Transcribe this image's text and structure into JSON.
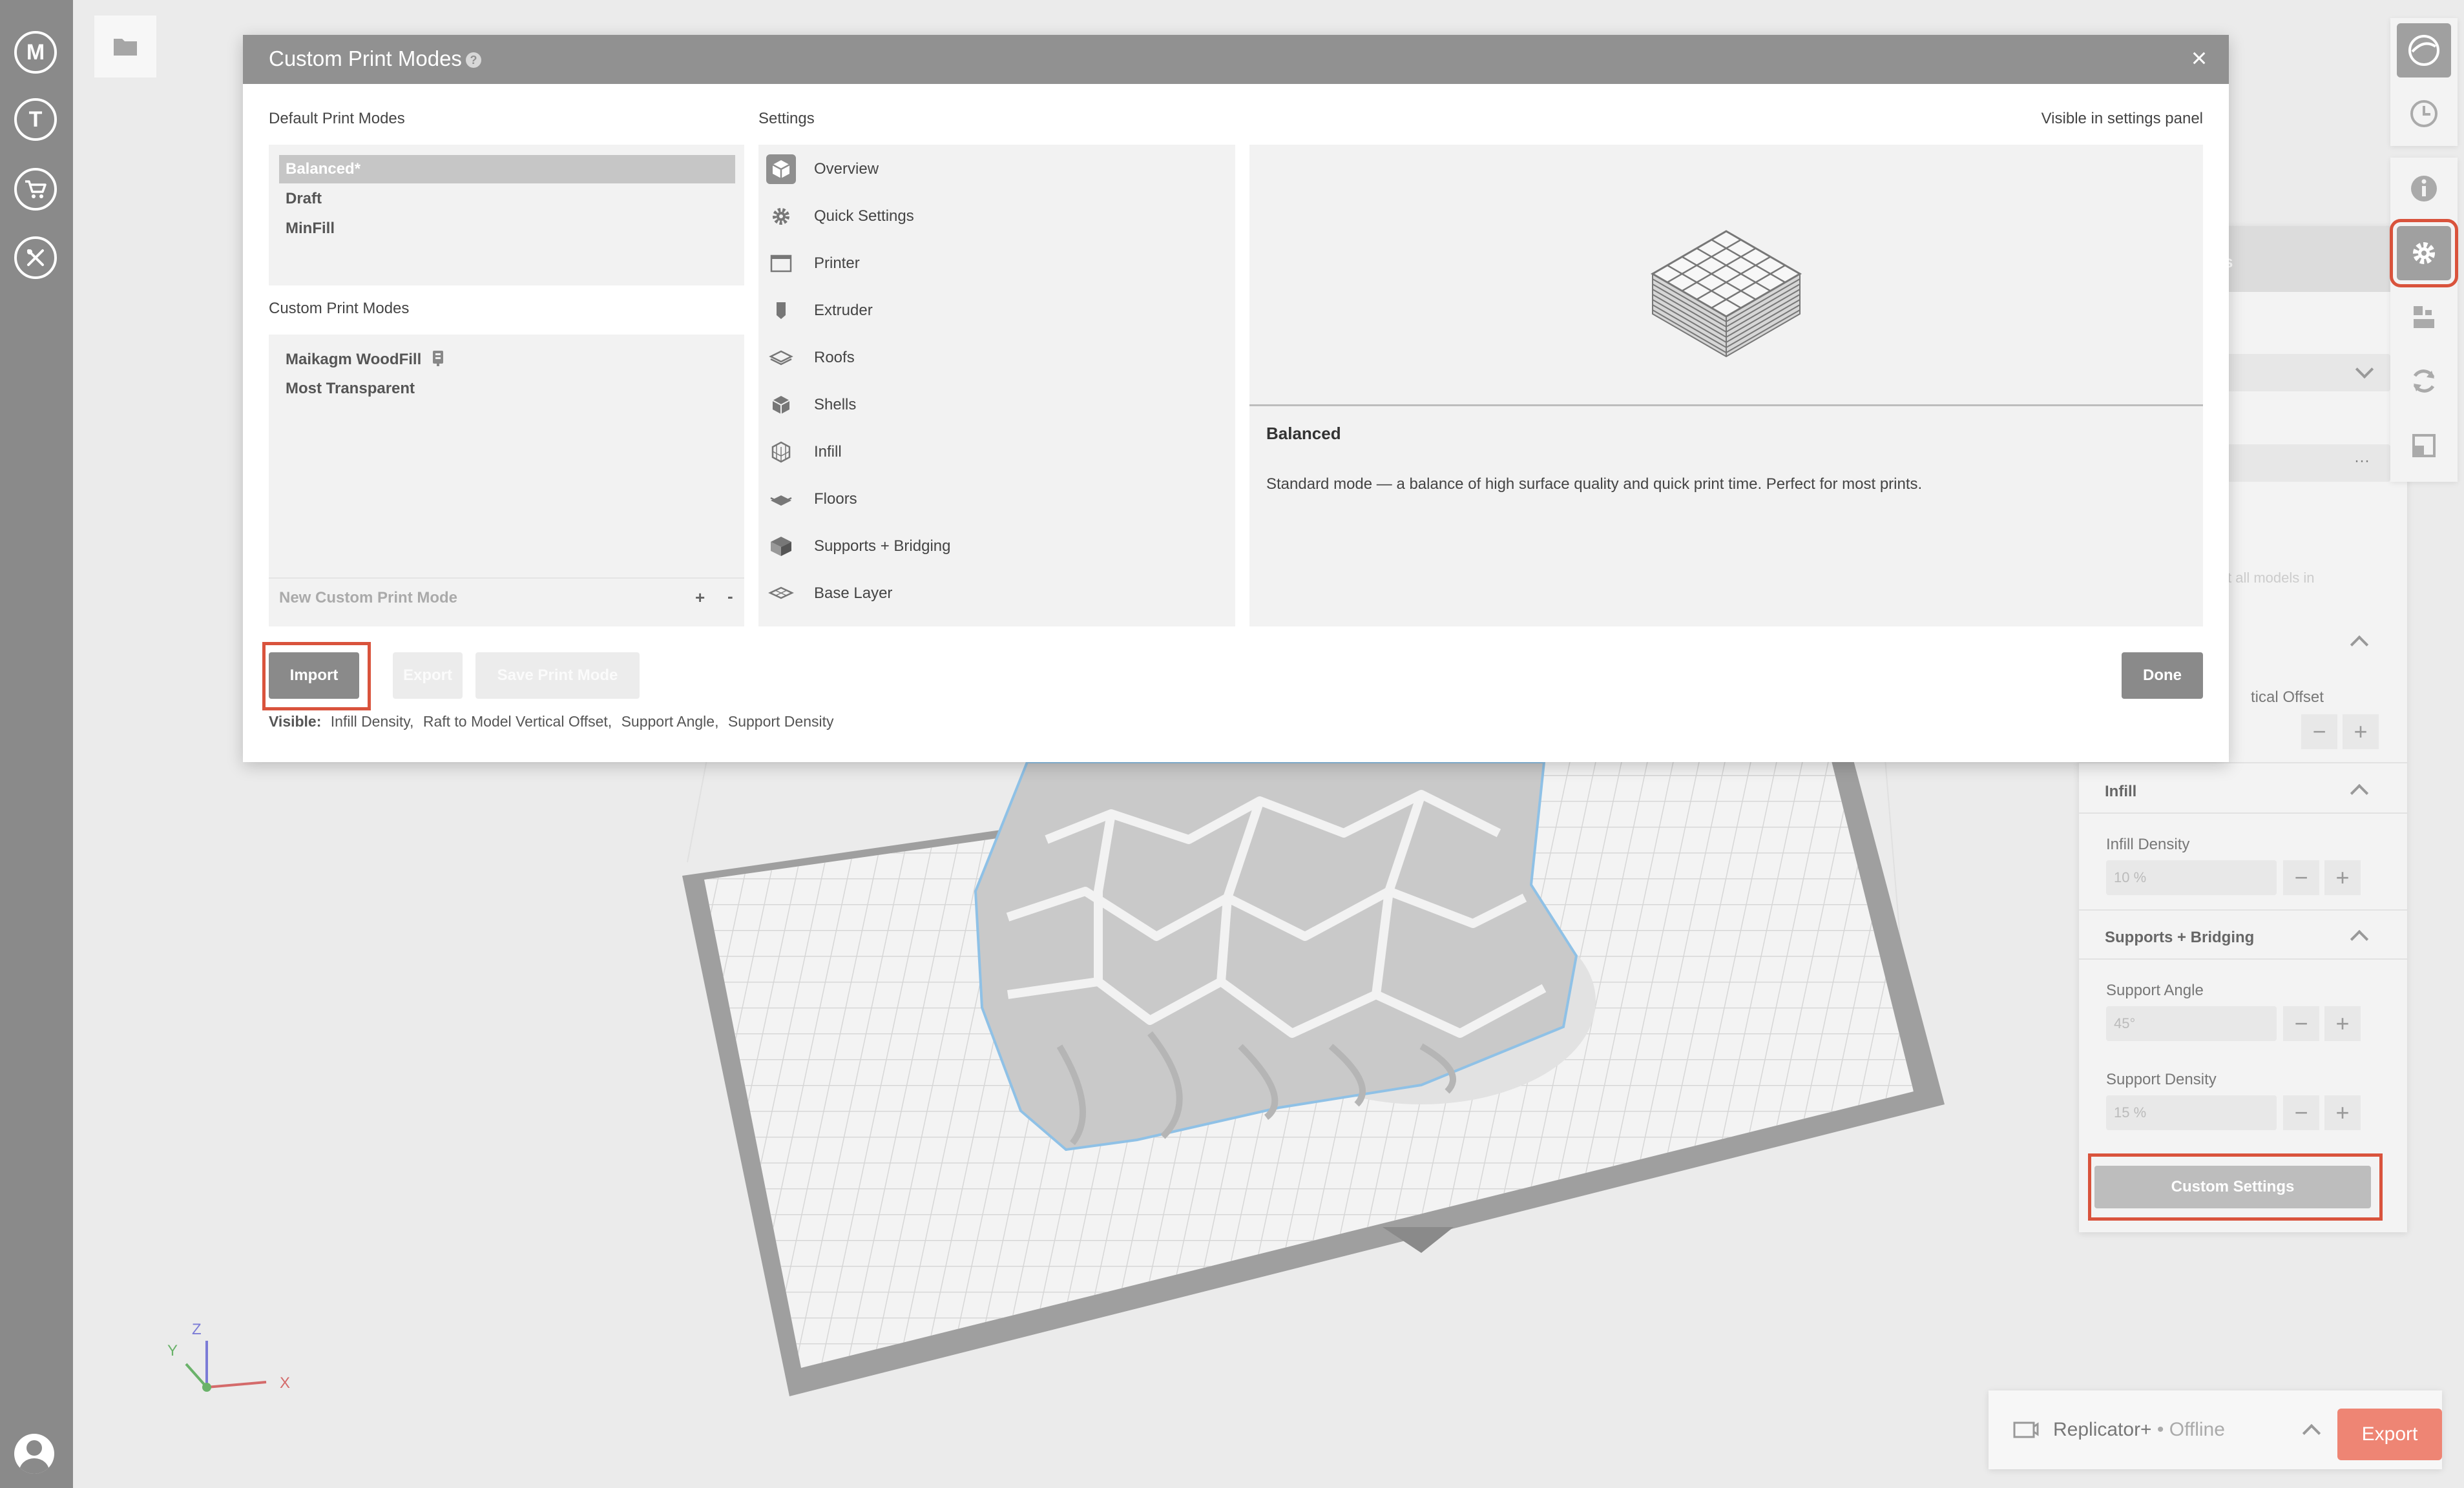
{
  "left_rail": {
    "items": [
      {
        "icon": "makerbot-logo-icon",
        "glyph": "M"
      },
      {
        "icon": "thingiverse-icon",
        "glyph": "T"
      },
      {
        "icon": "store-cart-icon"
      },
      {
        "icon": "utilities-tools-icon"
      }
    ],
    "account_icon": "account-avatar-icon"
  },
  "modal": {
    "title": "Custom Print Modes",
    "help_glyph": "?",
    "close_glyph": "×",
    "default_heading": "Default Print Modes",
    "default_modes": [
      "Balanced*",
      "Draft",
      "MinFill"
    ],
    "selected_default": "Balanced*",
    "custom_heading": "Custom Print Modes",
    "custom_modes": [
      "Maikagm WoodFill",
      "Most Transparent"
    ],
    "new_mode_placeholder": "New Custom Print Mode",
    "add_glyph": "+",
    "remove_glyph": "-",
    "settings_heading": "Settings",
    "visible_heading": "Visible in settings panel",
    "settings": [
      {
        "label": "Overview",
        "icon": "overview-cube-icon",
        "selected": true
      },
      {
        "label": "Quick Settings",
        "icon": "gear-icon"
      },
      {
        "label": "Printer",
        "icon": "printer-window-icon"
      },
      {
        "label": "Extruder",
        "icon": "extruder-icon"
      },
      {
        "label": "Roofs",
        "icon": "roofs-layer-icon"
      },
      {
        "label": "Shells",
        "icon": "shells-cube-icon"
      },
      {
        "label": "Infill",
        "icon": "infill-cube-icon"
      },
      {
        "label": "Floors",
        "icon": "floors-layer-icon"
      },
      {
        "label": "Supports + Bridging",
        "icon": "supports-bridging-icon"
      },
      {
        "label": "Base Layer",
        "icon": "base-layer-icon"
      }
    ],
    "detail_title": "Balanced",
    "detail_description": "Standard mode — a balance of high surface quality and quick print time. Perfect for most prints.",
    "buttons": {
      "import": "Import",
      "export": "Export",
      "save": "Save Print Mode",
      "done": "Done"
    },
    "visible_label": "Visible:",
    "visible_items": [
      "Infill Density,",
      "Raft to Model Vertical Offset,",
      "Support Angle,",
      "Support Density"
    ]
  },
  "right_panel": {
    "header_fragment": "s",
    "hint_fragment": "t all models in",
    "more_glyph": "···",
    "sections": {
      "raft_offset_label": "tical Offset",
      "infill": "Infill",
      "infill_density_label": "Infill Density",
      "infill_density_value": "10 %",
      "supports": "Supports + Bridging",
      "support_angle_label": "Support Angle",
      "support_angle_value": "45°",
      "support_density_label": "Support Density",
      "support_density_value": "15 %"
    },
    "minus_glyph": "−",
    "plus_glyph": "+",
    "custom_settings_button": "Custom Settings"
  },
  "tools": {
    "top": [
      "view-sphere-icon",
      "print-preview-icon"
    ],
    "bottom": [
      "info-icon",
      "settings-gear-icon",
      "arrange-icon",
      "rotate-icon",
      "scale-icon"
    ],
    "active": "settings-gear-icon"
  },
  "printer": {
    "name": "Replicator+",
    "status": " • Offline",
    "export_label": "Export"
  },
  "axes": {
    "x": "X",
    "y": "Y",
    "z": "Z"
  }
}
